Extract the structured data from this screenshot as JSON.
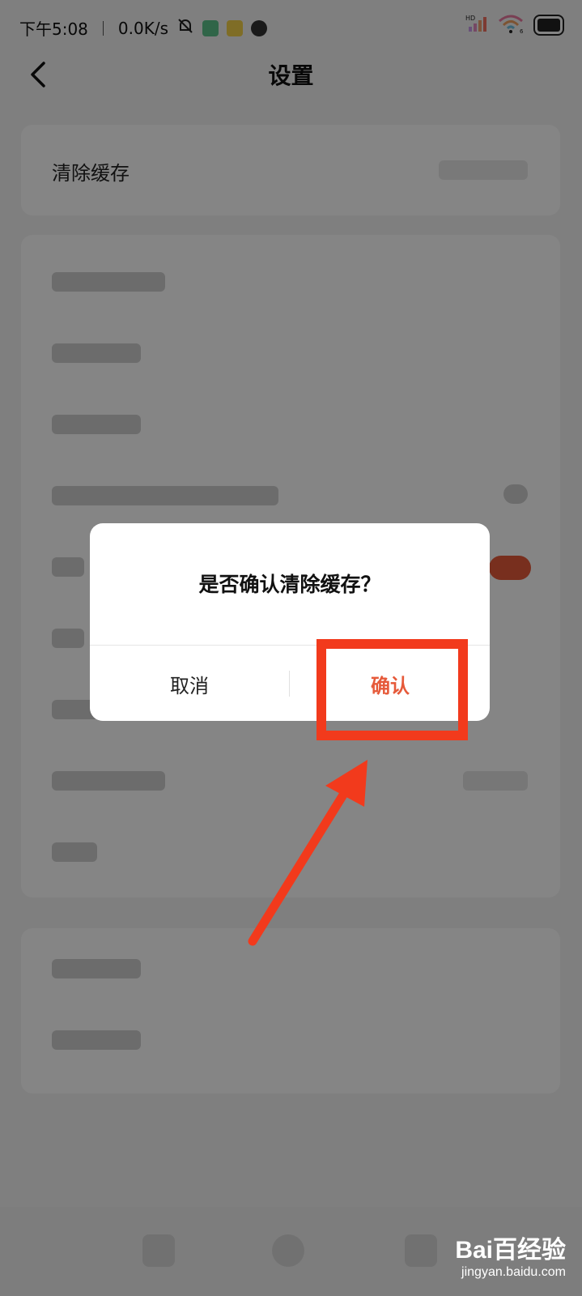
{
  "status_bar": {
    "time": "下午5:08",
    "net_speed": "0.0K/s",
    "signal_badge": "HD",
    "wifi_badge": "6"
  },
  "nav": {
    "title": "设置"
  },
  "settings": {
    "clear_cache_label": "清除缓存"
  },
  "dialog": {
    "message": "是否确认清除缓存？",
    "cancel_label": "取消",
    "confirm_label": "确认"
  },
  "watermark": {
    "logo_text": "Bai百经验",
    "url": "jingyan.baidu.com"
  },
  "colors": {
    "accent": "#e65a3a",
    "annotation_red": "#f23a1c",
    "overlay": "rgba(0,0,0,0.48)"
  },
  "icons": {
    "back": "chevron-left-icon",
    "mute": "bell-off-icon",
    "signal": "signal-icon",
    "wifi": "wifi-icon",
    "battery": "battery-icon"
  }
}
